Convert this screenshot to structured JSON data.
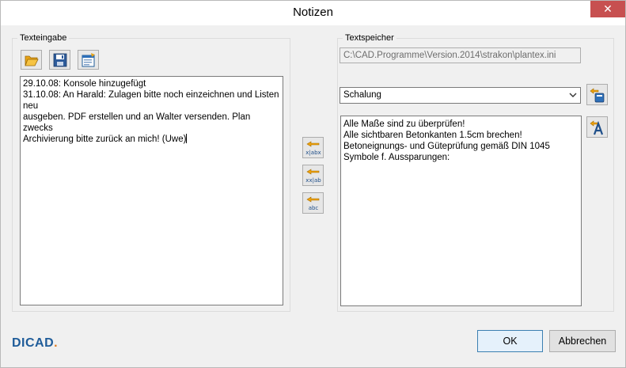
{
  "window": {
    "title": "Notizen",
    "close_label": "✕"
  },
  "left_panel": {
    "legend": "Texteingabe",
    "toolbar": {
      "open_icon": "folder-open-icon",
      "save_icon": "floppy-disk-icon",
      "export_icon": "export-document-icon"
    },
    "text_lines": [
      "29.10.08: Konsole hinzugefügt",
      "31.10.08: An Harald: Zulagen bitte noch einzeichnen und Listen neu",
      "ausgeben. PDF erstellen und an Walter versenden. Plan zwecks",
      "Archivierung bitte zurück an mich! (Uwe)"
    ]
  },
  "transfer_buttons": [
    {
      "icon": "insert-text-at-cursor-icon",
      "caption": "x|abx"
    },
    {
      "icon": "insert-text-append-icon",
      "caption": "xx|ab"
    },
    {
      "icon": "insert-text-replace-icon",
      "caption": "abc"
    }
  ],
  "right_panel": {
    "legend": "Textspeicher",
    "file_path": "C:\\CAD.Programme\\Version.2014\\strakon\\plantex.ini",
    "category_selected": "Schalung",
    "manage_icon": "edit-categories-icon",
    "font_icon": "font-settings-icon",
    "stored_lines": [
      "Alle Maße sind zu überprüfen!",
      "Alle sichtbaren Betonkanten 1.5cm brechen!",
      "Betoneignungs- und Güteprüfung gemäß DIN 1045",
      "Symbole f. Aussparungen:"
    ]
  },
  "footer": {
    "logo_text": "DICAD",
    "ok_label": "OK",
    "cancel_label": "Abbrechen"
  }
}
